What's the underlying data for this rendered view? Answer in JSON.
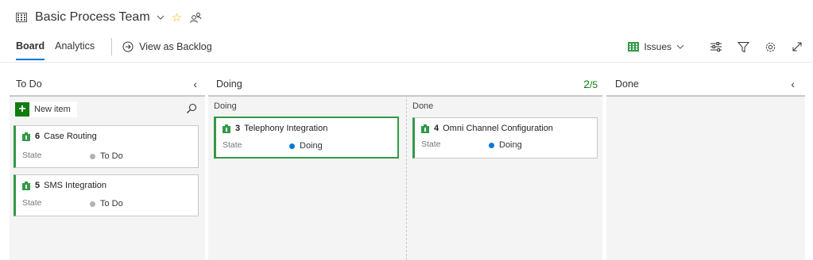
{
  "header": {
    "team_name": "Basic Process Team"
  },
  "tabs": [
    {
      "label": "Board"
    },
    {
      "label": "Analytics"
    }
  ],
  "view_backlog_label": "View as Backlog",
  "toolbar": {
    "backlog_level": "Issues"
  },
  "columns": [
    {
      "title": "To Do"
    },
    {
      "title": "Doing",
      "wip_current": "2",
      "wip_limit": "/5",
      "split": [
        "Doing",
        "Done"
      ]
    },
    {
      "title": "Done"
    }
  ],
  "new_item_label": "New item",
  "cards": [
    {
      "id": "6",
      "title": "Case Routing",
      "state_label": "State",
      "state": "To Do"
    },
    {
      "id": "5",
      "title": "SMS Integration",
      "state_label": "State",
      "state": "To Do"
    },
    {
      "id": "3",
      "title": "Telephony Integration",
      "state_label": "State",
      "state": "Doing"
    },
    {
      "id": "4",
      "title": "Omni Channel Configuration",
      "state_label": "State",
      "state": "Doing"
    }
  ],
  "colors": {
    "accent": "#0078d4",
    "issue_green": "#339947",
    "todo_dot": "#b2b2b2",
    "doing_dot": "#0078d4",
    "wip_green": "#107c10"
  }
}
